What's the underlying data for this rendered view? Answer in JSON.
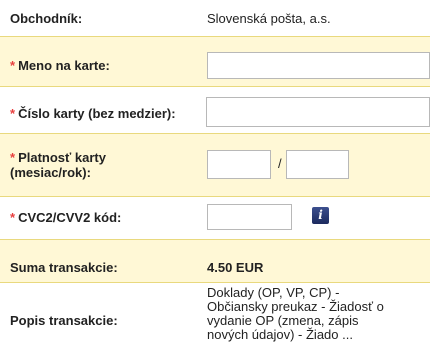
{
  "form": {
    "merchant": {
      "label": "Obchodník:",
      "value": "Slovenská pošta, a.s."
    },
    "card_name": {
      "required_mark": "*",
      "label": "Meno na karte:",
      "value": ""
    },
    "card_number": {
      "required_mark": "*",
      "label": "Číslo karty (bez medzier):",
      "value": ""
    },
    "expiry": {
      "required_mark": "*",
      "label_line1": "Platnosť karty",
      "label_line2": "(mesiac/rok):",
      "month": "",
      "year": "",
      "separator": "/"
    },
    "cvc": {
      "required_mark": "*",
      "label": "CVC2/CVV2 kód:",
      "value": "",
      "info_icon": "i"
    },
    "amount": {
      "label": "Suma transakcie:",
      "value": "4.50 EUR"
    },
    "description": {
      "label": "Popis transakcie:",
      "lines": [
        "Doklady (OP, VP, CP) -",
        "Občiansky preukaz - Žiadosť o",
        "vydanie OP (zmena, zápis",
        "nových údajov) - Žiado ..."
      ]
    }
  }
}
